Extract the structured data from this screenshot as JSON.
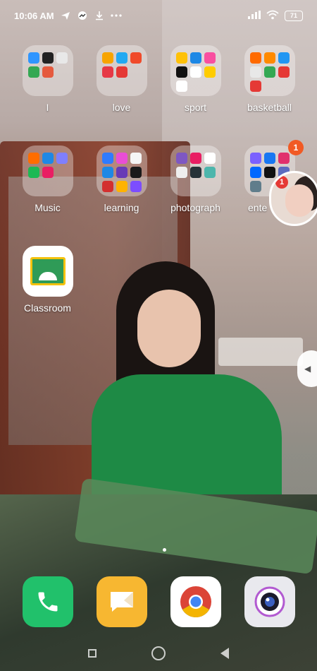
{
  "status_bar": {
    "time": "10:06 AM",
    "battery": "71"
  },
  "home_folders": [
    {
      "label": "I",
      "colors": [
        "#2f95ff",
        "#222222",
        "#e8e8e8",
        "#34a853",
        "#e55a3e"
      ]
    },
    {
      "label": "love",
      "colors": [
        "#f7a400",
        "#21a9f2",
        "#f04a2a",
        "#e63946",
        "#e53935"
      ]
    },
    {
      "label": "sport",
      "colors": [
        "#ffc107",
        "#1e88e5",
        "#f94fa0",
        "#111111",
        "#ffffff",
        "#ffcc00",
        "#ffffff"
      ]
    },
    {
      "label": "basketball",
      "colors": [
        "#ff6a00",
        "#ff8a00",
        "#2196f3",
        "#e8e8e8",
        "#34a853",
        "#e53935",
        "#e53935"
      ]
    },
    {
      "label": "Music",
      "colors": [
        "#ff6d00",
        "#1e88e5",
        "#7f7fff",
        "#1db954",
        "#e91e63"
      ]
    },
    {
      "label": "learning",
      "colors": [
        "#2f7bff",
        "#e94dd5",
        "#f5f5f5",
        "#1e88e5",
        "#673ab7",
        "#1a1a1a",
        "#d32f2f",
        "#ffb300",
        "#7c4dff"
      ]
    },
    {
      "label": "photograph",
      "colors": [
        "#7e57c2",
        "#e91e63",
        "#ffffff",
        "#eeeeee",
        "#263238",
        "#4db6ac"
      ]
    },
    {
      "label": "ente",
      "badge": "1",
      "colors": [
        "#7b61ff",
        "#1877f2",
        "#e1306c",
        "#0068ff",
        "#111111",
        "#5c6bc0",
        "#607d8b"
      ]
    }
  ],
  "apps": {
    "classroom_label": "Classroom"
  },
  "chat_head": {
    "badge": "1"
  }
}
